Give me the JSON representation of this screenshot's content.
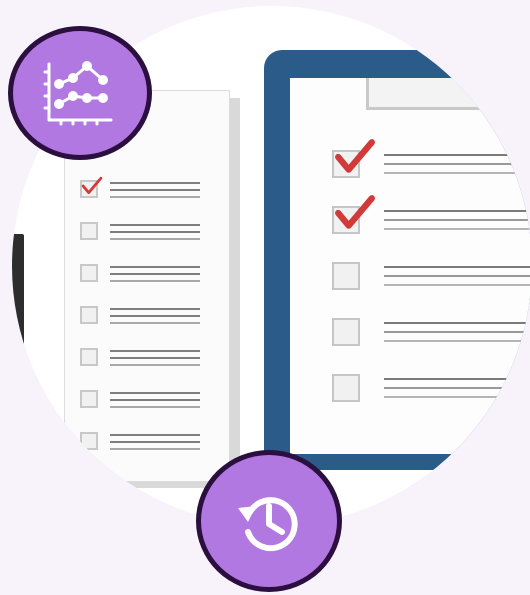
{
  "paper_checklist": {
    "items": [
      {
        "checked": true
      },
      {
        "checked": false
      },
      {
        "checked": false
      },
      {
        "checked": false
      },
      {
        "checked": false
      },
      {
        "checked": false
      },
      {
        "checked": false
      }
    ]
  },
  "clipboard_checklist": {
    "items": [
      {
        "checked": true
      },
      {
        "checked": true
      },
      {
        "checked": false
      },
      {
        "checked": false
      },
      {
        "checked": false
      }
    ]
  },
  "badges": {
    "analytics": {
      "icon": "line-chart-icon"
    },
    "history": {
      "icon": "history-clock-icon"
    }
  },
  "colors": {
    "background": "#f8f2fb",
    "badge_fill": "#b078e0",
    "badge_border": "#2a0f3f",
    "clipboard": "#2b5b89",
    "check": "#d23a3a"
  }
}
